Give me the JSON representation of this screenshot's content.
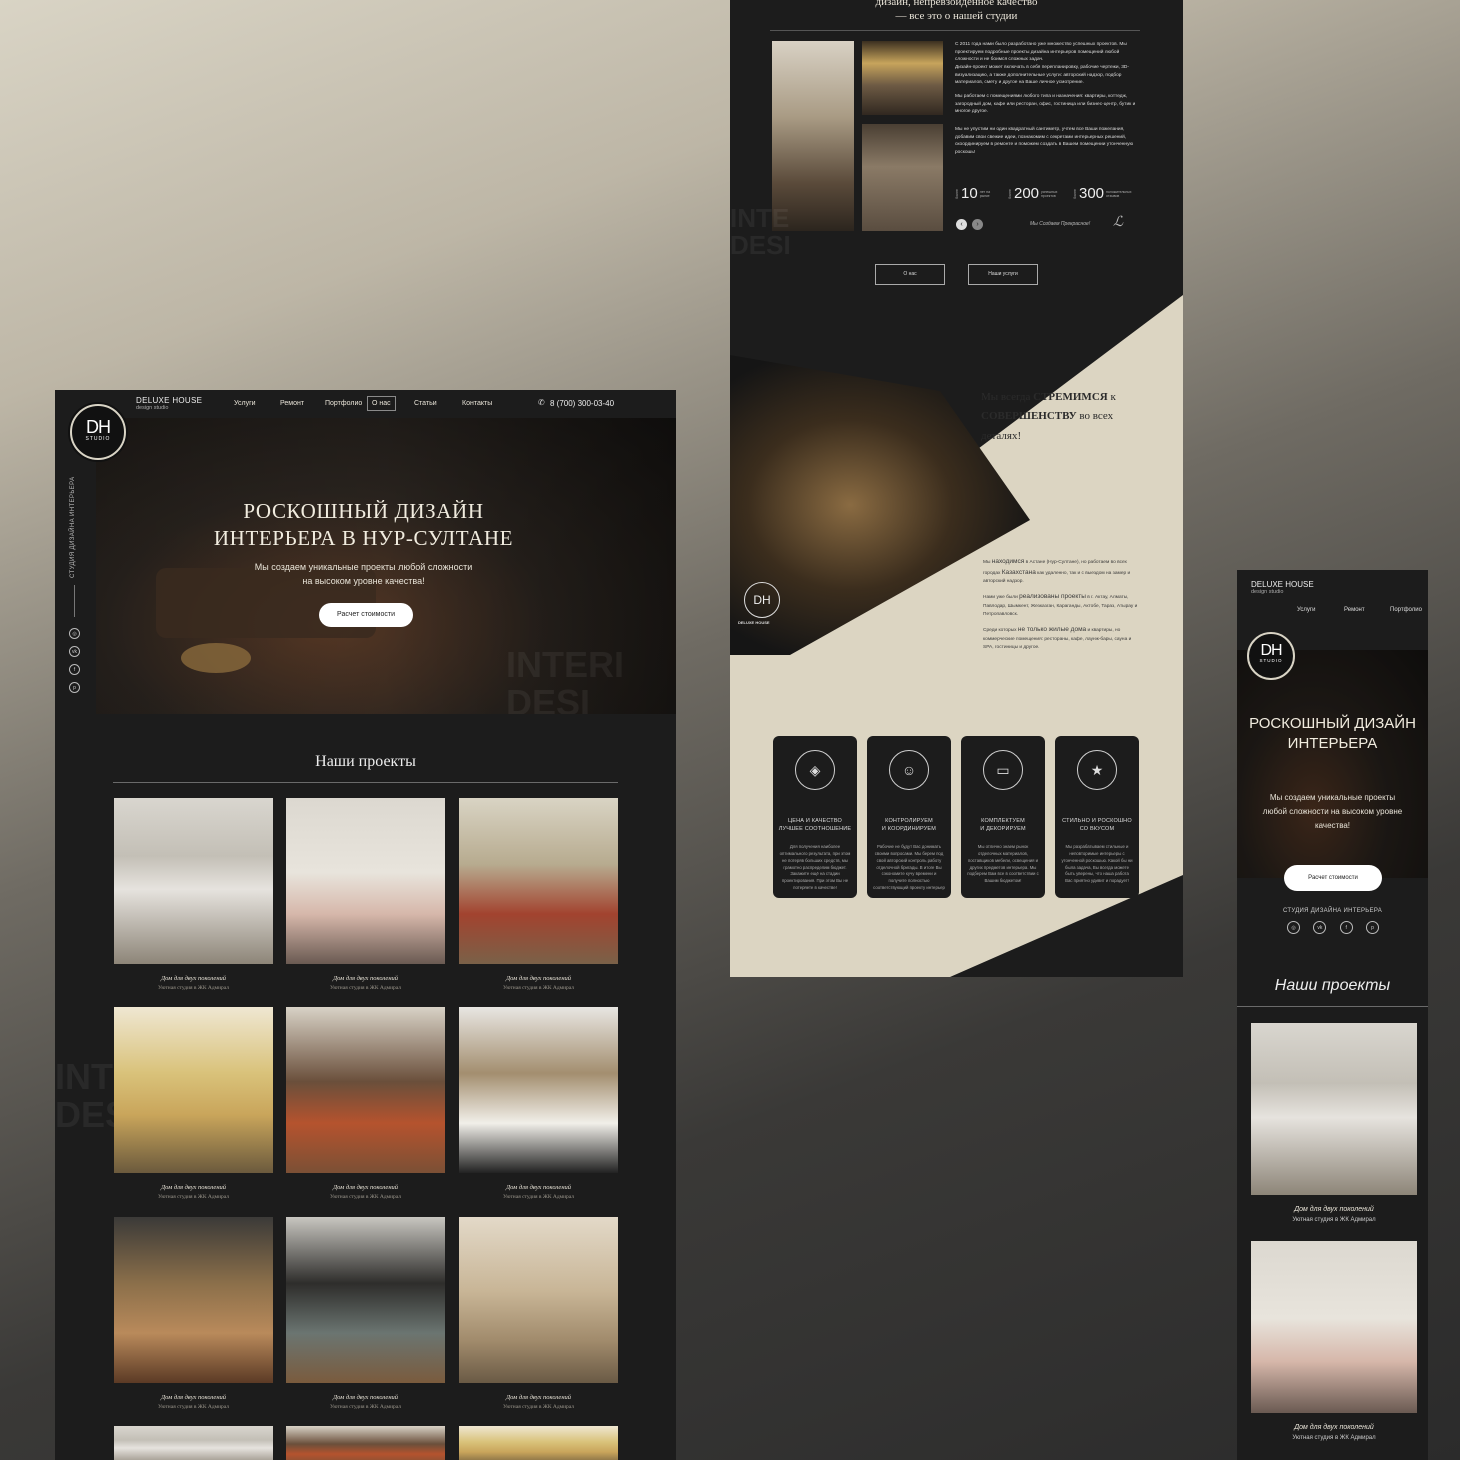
{
  "desktop": {
    "brand": {
      "name": "DELUXE HOUSE",
      "sub": "design studio",
      "logo": "DH",
      "logo_sub": "STUDIO"
    },
    "nav": [
      "Услуги",
      "Ремонт",
      "Портфолио",
      "О нас",
      "Статьи",
      "Контакты"
    ],
    "phone": "8 (700) 300-03-40",
    "side_text": "СТУДИЯ ДИЗАЙНА ИНТЕРЬЕРА",
    "hero": {
      "title_line1": "РОСКОШНЫЙ ДИЗАЙН",
      "title_line2": "ИНТЕРЬЕРА В НУР-СУЛТАНЕ",
      "subtitle_line1": "Мы создаем уникальные проекты любой сложности",
      "subtitle_line2": "на высоком уровне качества!",
      "cta": "Расчет стоимости",
      "watermark_line1": "INTERI",
      "watermark_line2": "DESI"
    },
    "projects": {
      "heading": "Наши проекты",
      "watermark_line1": "INTE",
      "watermark_line2": "DESI",
      "items": [
        {
          "title": "Дом для двух поколений",
          "sub": "Уютная студия в ЖК Адмирал"
        },
        {
          "title": "Дом для двух поколений",
          "sub": "Уютная студия в ЖК Адмирал"
        },
        {
          "title": "Дом для двух поколений",
          "sub": "Уютная студия в ЖК Адмирал"
        },
        {
          "title": "Дом для двух поколений",
          "sub": "Уютная студия в ЖК Адмирал"
        },
        {
          "title": "Дом для двух поколений",
          "sub": "Уютная студия в ЖК Адмирал"
        },
        {
          "title": "Дом для двух поколений",
          "sub": "Уютная студия в ЖК Адмирал"
        },
        {
          "title": "Дом для двух поколений",
          "sub": "Уютная студия в ЖК Адмирал"
        },
        {
          "title": "Дом для двух поколений",
          "sub": "Уютная студия в ЖК Адмирал"
        },
        {
          "title": "Дом для двух поколений",
          "sub": "Уютная студия в ЖК Адмирал"
        }
      ]
    }
  },
  "about": {
    "heading_line1": "дизайн, непревзойденное качество",
    "heading_line2": "— все это о нашей студии",
    "para1": "С 2011 года нами было разработано уже множество успешных проектов. Мы проектируем подробные проекты дизайна интерьеров помещений любой сложности и не боимся сложных задач.",
    "para1b": "Дизайн-проект может включать в себя перепланировку, рабочие чертежи, 3D-визуализацию, а также дополнительные услуги: авторский надзор, подбор материалов, смету и другое на Ваше личное усмотрение.",
    "para2": "Мы работаем с помещениями любого типа и назначения: квартиры, коттедж, загородный дом, кафе или ресторан, офис, гостиница или бизнес-центр, бутик и многое другое.",
    "para3": "Мы не упустим ни один квадратный сантиметр, учтем все Ваши пожелания, добавим свои свежие идеи, познакомим с секретами интерьерных решений, скоординируем в ремонте и поможем создать в Вашем помещении утонченную роскошь!",
    "stats": [
      {
        "pre": "более",
        "num": "10",
        "label": "лет на рынке"
      },
      {
        "pre": "более",
        "num": "200",
        "label": "успешных проектов"
      },
      {
        "pre": "более",
        "num": "300",
        "label": "положительных отзывов"
      }
    ],
    "signature_text": "Мы Создаем Прекрасное!",
    "btn_about": "О нас",
    "btn_projects": "Наши услуги",
    "watermark_line1": "INTE",
    "watermark_line2": "DESI"
  },
  "mission": {
    "line1_a": "Мы всегда ",
    "line1_b": "СТРЕМИМСЯ",
    "line1_c": " к",
    "line2_a": "СОВЕРШЕНСТВУ",
    "line2_b": " во всех",
    "line3": "деталях!",
    "magazine_logo": "DH",
    "magazine_brand": "DELUXE HOUSE",
    "p1_a": "Мы ",
    "p1_b": "находимся",
    "p1_c": " в Астане (Нур-Султане), но работаем во всех городах ",
    "p1_d": "Казахстана",
    "p1_e": " как удаленно, так и с выездом на замер и авторский надзор.",
    "p2_a": "Нами уже были ",
    "p2_b": "реализованы проекты",
    "p2_c": " в г. Актау, Алматы, Павлодар, Шымкент, Жезказган, Караганды, Актобе, Тараз, Атырау и Петропавловск.",
    "p3_a": "Среди которых ",
    "p3_b": "не только жилые дома",
    "p3_c": " и квартиры, но коммерческие помещения: рестораны, кафе, лаунж-бары, сауна и SPA, гостиницы и другое."
  },
  "features": [
    {
      "icon": "price-tag-icon",
      "glyph": "◈",
      "title1": "ЦЕНА И КАЧЕСТВО",
      "title2": "ЛУЧШЕЕ СООТНОШЕНИЕ",
      "desc": "Для получения наиболее оптимального результата, при этом не потеряв больших средств, мы грамотно распределим бюджет. Закажите ещё на стадии проектирования. При этом Вы не потеряете в качестве!"
    },
    {
      "icon": "worker-icon",
      "glyph": "☺",
      "title1": "КОНТРОЛИРУЕМ",
      "title2": "И КООРДИНИРУЕМ",
      "desc": "Рабочие не будут Вас донимать своими вопросами. Мы берем под свой авторский контроль работу отделочной бригады. В итоге Вы сэкономите кучу времени и получите полностью соответствующий проекту интерьер"
    },
    {
      "icon": "sofa-icon",
      "glyph": "▭",
      "title1": "КОМПЛЕКТУЕМ",
      "title2": "И ДЕКОРИРУЕМ",
      "desc": "Мы отлично знаем рынок отделочных материалов, поставщиков мебели, освещения и других предметов интерьера. Мы подберем Вам все в соответствии с Вашим бюджетом!"
    },
    {
      "icon": "stars-icon",
      "glyph": "★",
      "title1": "СТИЛЬНО И РОСКОШНО",
      "title2": "СО ВКУСОМ",
      "desc": "Мы разрабатываем стильные и неповторимые интерьеры с утонченной роскошью. Какой бы ни была задача, Вы всегда можете быть уверены, что наша работа Вас приятно удивит и порадует!"
    }
  ],
  "mobile": {
    "brand": "DELUXE HOUSE",
    "sub": "design studio",
    "nav": [
      "Услуги",
      "Ремонт",
      "Портфолио"
    ],
    "logo": "DH",
    "logo_sub": "STUDIO",
    "hero_line1": "РОСКОШНЫЙ ДИЗАЙН",
    "hero_line2": "ИНТЕРЬЕРА",
    "subtitle": "Мы создаем уникальные проекты любой сложности на высоком уровне качества!",
    "cta": "Расчет стоимости",
    "side_text": "СТУДИЯ ДИЗАЙНА ИНТЕРЬЕРА",
    "projects_heading": "Наши проекты",
    "items": [
      {
        "title": "Дом для двух поколений",
        "sub": "Уютная студия в ЖК Адмирал"
      },
      {
        "title": "Дом для двух поколений",
        "sub": "Уютная студия в ЖК Адмирал"
      }
    ]
  },
  "social": [
    "instagram-icon",
    "vk-icon",
    "facebook-icon",
    "pinterest-icon"
  ],
  "colors": {
    "dark": "#1b1b1b",
    "beige": "#dcd5c2",
    "gold": "#c9a15a"
  }
}
